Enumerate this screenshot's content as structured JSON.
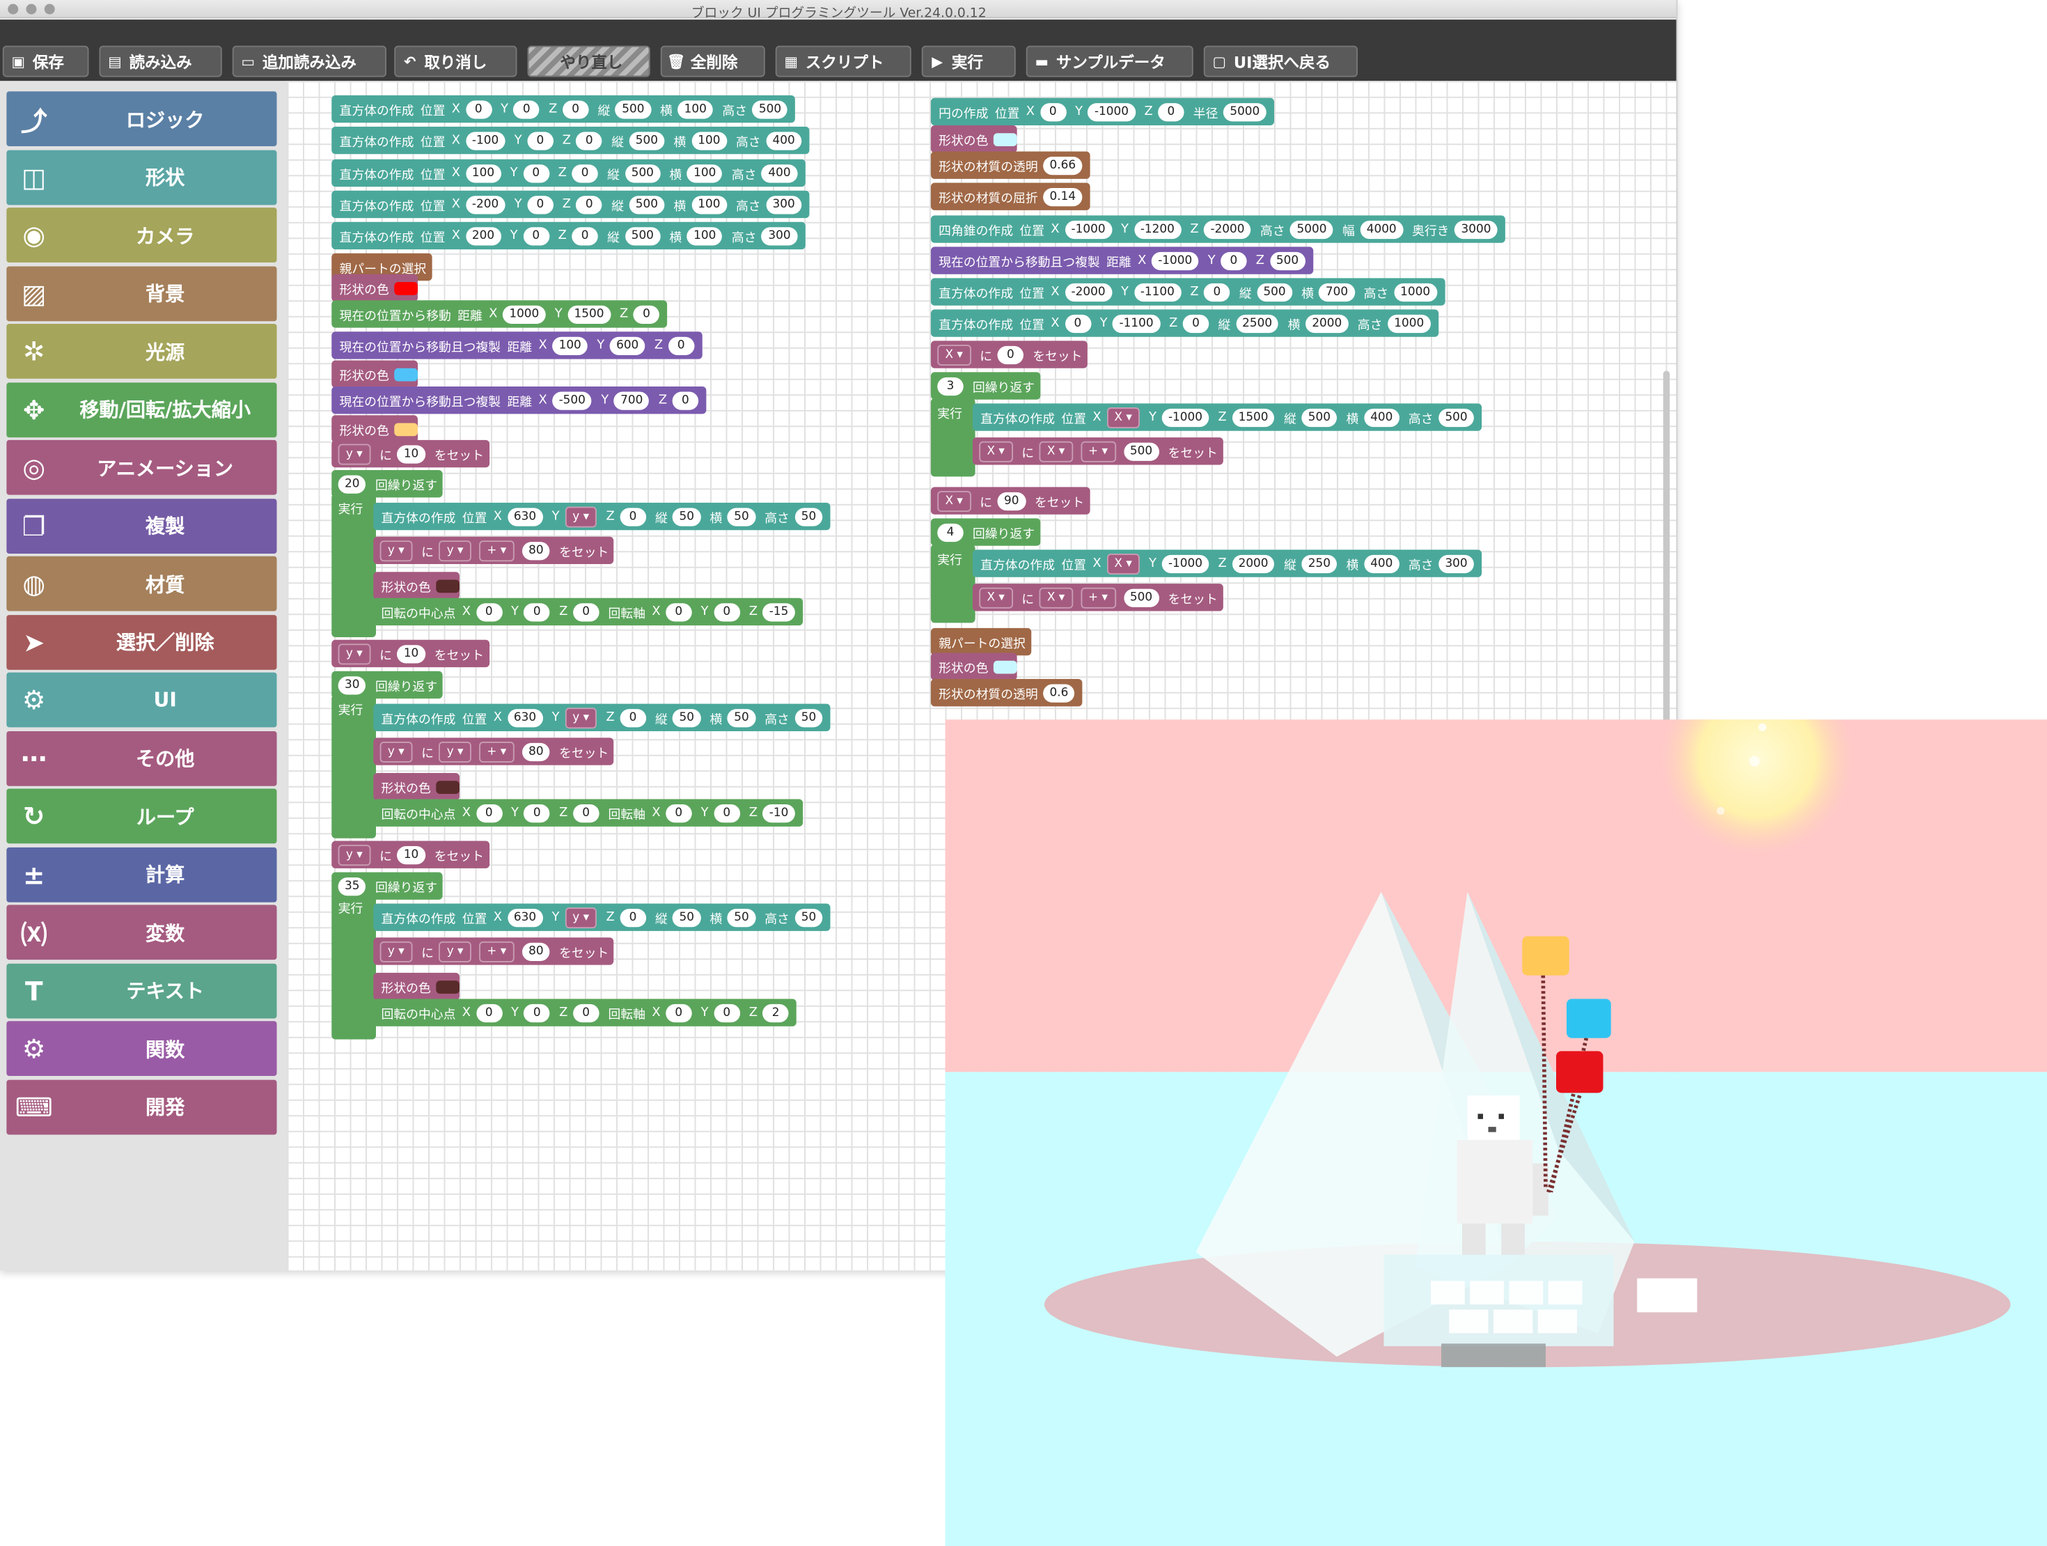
{
  "window": {
    "title": "ブロック UI プログラミングツール Ver.24.0.0.12"
  },
  "toolbar": {
    "save": "保存",
    "load": "読み込み",
    "add_load": "追加読み込み",
    "undo": "取り消し",
    "redo": "やり直し",
    "delete_all": "全削除",
    "script": "スクリプト",
    "run": "実行",
    "sample": "サンプルデータ",
    "back": "UI選択へ戻る"
  },
  "categories": [
    {
      "label": "ロジック",
      "color": "#5b80a5",
      "icon": "logic-icon"
    },
    {
      "label": "形状",
      "color": "#5ba5a5",
      "icon": "cube-icon"
    },
    {
      "label": "カメラ",
      "color": "#a5a55b",
      "icon": "camera-icon"
    },
    {
      "label": "背景",
      "color": "#a5805b",
      "icon": "background-icon"
    },
    {
      "label": "光源",
      "color": "#a5a55b",
      "icon": "sun-icon"
    },
    {
      "label": "移動/回転/拡大縮小",
      "color": "#5ba55b",
      "icon": "move-icon"
    },
    {
      "label": "アニメーション",
      "color": "#a55b80",
      "icon": "animation-icon"
    },
    {
      "label": "複製",
      "color": "#745ba5",
      "icon": "copy-icon"
    },
    {
      "label": "材質",
      "color": "#a5805b",
      "icon": "globe-icon"
    },
    {
      "label": "選択／削除",
      "color": "#a55b5b",
      "icon": "pointer-icon"
    },
    {
      "label": "UI",
      "color": "#5ba5a5",
      "icon": "gears-icon"
    },
    {
      "label": "その他",
      "color": "#a55b80",
      "icon": "more-icon"
    },
    {
      "label": "ループ",
      "color": "#5ba55b",
      "icon": "loop-icon"
    },
    {
      "label": "計算",
      "color": "#5b67a5",
      "icon": "calc-icon"
    },
    {
      "label": "変数",
      "color": "#a55b80",
      "icon": "variable-icon"
    },
    {
      "label": "テキスト",
      "color": "#5ba58c",
      "icon": "text-icon"
    },
    {
      "label": "関数",
      "color": "#995ba5",
      "icon": "function-icon"
    },
    {
      "label": "開発",
      "color": "#a55b80",
      "icon": "dev-icon"
    }
  ],
  "left_script": [
    {
      "c": "teal",
      "t": [
        "直方体の作成",
        "位置",
        "X",
        "[0]",
        "Y",
        "[0]",
        "Z",
        "[0]",
        "縦",
        "[500]",
        "横",
        "[100]",
        "高さ",
        "[500]"
      ]
    },
    {
      "c": "teal",
      "t": [
        "直方体の作成",
        "位置",
        "X",
        "[-100]",
        "Y",
        "[0]",
        "Z",
        "[0]",
        "縦",
        "[500]",
        "横",
        "[100]",
        "高さ",
        "[400]"
      ]
    },
    {
      "c": "teal",
      "t": [
        "直方体の作成",
        "位置",
        "X",
        "[100]",
        "Y",
        "[0]",
        "Z",
        "[0]",
        "縦",
        "[500]",
        "横",
        "[100]",
        "高さ",
        "[400]"
      ]
    },
    {
      "c": "teal",
      "t": [
        "直方体の作成",
        "位置",
        "X",
        "[-200]",
        "Y",
        "[0]",
        "Z",
        "[0]",
        "縦",
        "[500]",
        "横",
        "[100]",
        "高さ",
        "[300]"
      ]
    },
    {
      "c": "teal",
      "t": [
        "直方体の作成",
        "位置",
        "X",
        "[200]",
        "Y",
        "[0]",
        "Z",
        "[0]",
        "縦",
        "[500]",
        "横",
        "[100]",
        "高さ",
        "[300]"
      ]
    },
    {
      "c": "brown",
      "t": [
        "親パートの選択"
      ]
    },
    {
      "c": "pink",
      "t": [
        "形状の色",
        "#ff0000"
      ]
    },
    {
      "c": "green",
      "t": [
        "現在の位置から移動",
        "距離",
        "X",
        "[1000]",
        "Y",
        "[1500]",
        "Z",
        "[0]"
      ]
    },
    {
      "c": "purple",
      "t": [
        "現在の位置から移動且つ複製",
        "距離",
        "X",
        "[100]",
        "Y",
        "[600]",
        "Z",
        "[0]"
      ]
    },
    {
      "c": "pink",
      "t": [
        "形状の色",
        "#4fc3f7"
      ]
    },
    {
      "c": "purple",
      "t": [
        "現在の位置から移動且つ複製",
        "距離",
        "X",
        "[-500]",
        "Y",
        "[700]",
        "Z",
        "[0]"
      ]
    },
    {
      "c": "pink",
      "t": [
        "形状の色",
        "#ffd27a"
      ]
    },
    {
      "c": "pink",
      "t": [
        "{y ▾}",
        "に",
        "[10]",
        "をセット"
      ]
    },
    {
      "c": "green",
      "t": [
        "[20]",
        "回繰り返す"
      ]
    },
    {
      "c": "teal",
      "t": [
        "直方体の作成",
        "位置",
        "X",
        "[630]",
        "Y",
        "{y ▾}",
        "Z",
        "[0]",
        "縦",
        "[50]",
        "横",
        "[50]",
        "高さ",
        "[50]"
      ]
    },
    {
      "c": "pink",
      "t": [
        "{y ▾}",
        "に",
        "{y ▾}",
        "{+ ▾}",
        "[80]",
        "をセット"
      ]
    },
    {
      "c": "pink",
      "t": [
        "形状の色",
        "#5a2b2b"
      ]
    },
    {
      "c": "green",
      "t": [
        "回転の中心点",
        "X",
        "[0]",
        "Y",
        "[0]",
        "Z",
        "[0]",
        "回転軸",
        "X",
        "[0]",
        "Y",
        "[0]",
        "Z",
        "[-15]"
      ]
    },
    {
      "c": "pink",
      "t": [
        "{y ▾}",
        "に",
        "[10]",
        "をセット"
      ]
    },
    {
      "c": "green",
      "t": [
        "[30]",
        "回繰り返す"
      ]
    },
    {
      "c": "teal",
      "t": [
        "直方体の作成",
        "位置",
        "X",
        "[630]",
        "Y",
        "{y ▾}",
        "Z",
        "[0]",
        "縦",
        "[50]",
        "横",
        "[50]",
        "高さ",
        "[50]"
      ]
    },
    {
      "c": "pink",
      "t": [
        "{y ▾}",
        "に",
        "{y ▾}",
        "{+ ▾}",
        "[80]",
        "をセット"
      ]
    },
    {
      "c": "pink",
      "t": [
        "形状の色",
        "#5a2b2b"
      ]
    },
    {
      "c": "green",
      "t": [
        "回転の中心点",
        "X",
        "[0]",
        "Y",
        "[0]",
        "Z",
        "[0]",
        "回転軸",
        "X",
        "[0]",
        "Y",
        "[0]",
        "Z",
        "[-10]"
      ]
    },
    {
      "c": "pink",
      "t": [
        "{y ▾}",
        "に",
        "[10]",
        "をセット"
      ]
    },
    {
      "c": "green",
      "t": [
        "[35]",
        "回繰り返す"
      ]
    },
    {
      "c": "teal",
      "t": [
        "直方体の作成",
        "位置",
        "X",
        "[630]",
        "Y",
        "{y ▾}",
        "Z",
        "[0]",
        "縦",
        "[50]",
        "横",
        "[50]",
        "高さ",
        "[50]"
      ]
    },
    {
      "c": "pink",
      "t": [
        "{y ▾}",
        "に",
        "{y ▾}",
        "{+ ▾}",
        "[80]",
        "をセット"
      ]
    },
    {
      "c": "pink",
      "t": [
        "形状の色",
        "#5a2b2b"
      ]
    },
    {
      "c": "green",
      "t": [
        "回転の中心点",
        "X",
        "[0]",
        "Y",
        "[0]",
        "Z",
        "[0]",
        "回転軸",
        "X",
        "[0]",
        "Y",
        "[0]",
        "Z",
        "[2]"
      ]
    }
  ],
  "right_script": [
    {
      "c": "teal",
      "t": [
        "円の作成",
        "位置",
        "X",
        "[0]",
        "Y",
        "[-1000]",
        "Z",
        "[0]",
        "半径",
        "[5000]"
      ]
    },
    {
      "c": "pink",
      "t": [
        "形状の色",
        "#c9f7ff"
      ]
    },
    {
      "c": "brown",
      "t": [
        "形状の材質の透明",
        "[0.66]"
      ]
    },
    {
      "c": "brown",
      "t": [
        "形状の材質の屈折",
        "[0.14]"
      ]
    },
    {
      "c": "teal",
      "t": [
        "四角錐の作成",
        "位置",
        "X",
        "[-1000]",
        "Y",
        "[-1200]",
        "Z",
        "[-2000]",
        "高さ",
        "[5000]",
        "幅",
        "[4000]",
        "奥行き",
        "[3000]"
      ]
    },
    {
      "c": "purple",
      "t": [
        "現在の位置から移動且つ複製",
        "距離",
        "X",
        "[-1000]",
        "Y",
        "[0]",
        "Z",
        "[500]"
      ]
    },
    {
      "c": "teal",
      "t": [
        "直方体の作成",
        "位置",
        "X",
        "[-2000]",
        "Y",
        "[-1100]",
        "Z",
        "[0]",
        "縦",
        "[500]",
        "横",
        "[700]",
        "高さ",
        "[1000]"
      ]
    },
    {
      "c": "teal",
      "t": [
        "直方体の作成",
        "位置",
        "X",
        "[0]",
        "Y",
        "[-1100]",
        "Z",
        "[0]",
        "縦",
        "[2500]",
        "横",
        "[2000]",
        "高さ",
        "[1000]"
      ]
    },
    {
      "c": "pink",
      "t": [
        "{X ▾}",
        "に",
        "[0]",
        "をセット"
      ]
    },
    {
      "c": "green",
      "t": [
        "[3]",
        "回繰り返す"
      ]
    },
    {
      "c": "teal",
      "t": [
        "直方体の作成",
        "位置",
        "X",
        "{X ▾}",
        "Y",
        "[-1000]",
        "Z",
        "[1500]",
        "縦",
        "[500]",
        "横",
        "[400]",
        "高さ",
        "[500]"
      ]
    },
    {
      "c": "pink",
      "t": [
        "{X ▾}",
        "に",
        "{X ▾}",
        "{+ ▾}",
        "[500]",
        "をセット"
      ]
    },
    {
      "c": "pink",
      "t": [
        "{X ▾}",
        "に",
        "[90]",
        "をセット"
      ]
    },
    {
      "c": "green",
      "t": [
        "[4]",
        "回繰り返す"
      ]
    },
    {
      "c": "teal",
      "t": [
        "直方体の作成",
        "位置",
        "X",
        "{X ▾}",
        "Y",
        "[-1000]",
        "Z",
        "[2000]",
        "縦",
        "[250]",
        "横",
        "[400]",
        "高さ",
        "[300]"
      ]
    },
    {
      "c": "pink",
      "t": [
        "{X ▾}",
        "に",
        "{X ▾}",
        "{+ ▾}",
        "[500]",
        "をセット"
      ]
    },
    {
      "c": "brown",
      "t": [
        "親パートの選択"
      ]
    },
    {
      "c": "pink",
      "t": [
        "形状の色",
        "#c9f7ff"
      ]
    },
    {
      "c": "brown",
      "t": [
        "形状の材質の透明",
        "[0.6]"
      ]
    }
  ],
  "loop_exec_label": "実行",
  "colors": {
    "teal": "#4aa89a",
    "pink": "#a55b80",
    "purple": "#7b5bae",
    "brown": "#a06846",
    "green": "#5ba55b"
  }
}
